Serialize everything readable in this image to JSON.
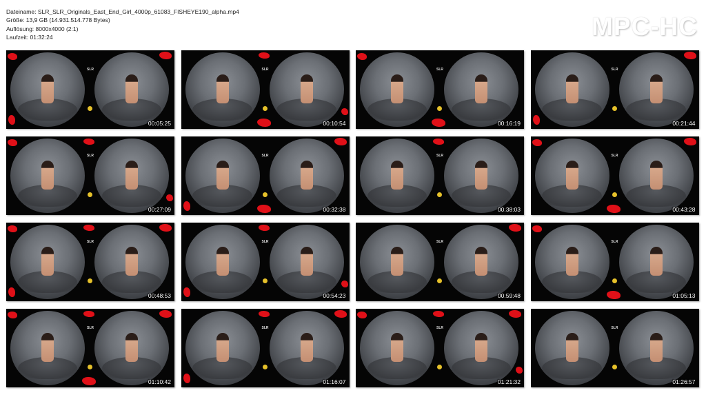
{
  "header": {
    "filename_line": "Dateiname: SLR_SLR_Originals_East_End_Girl_4000p_61083_FISHEYE190_alpha.mp4",
    "size_line": "Größe: 13,9 GB (14.931.514.778 Bytes)",
    "resolution_line": "Auflösung: 8000x4000 (2:1)",
    "duration_line": "Laufzeit: 01:32:24",
    "brand": "MPC-HC"
  },
  "thumbnail_logo": "SLR",
  "colors": {
    "background": "#ffffff",
    "thumb_background": "#050505",
    "splatter": "#e01018",
    "timestamp": "#ffffff"
  },
  "thumbnails": [
    {
      "time": "00:05:25"
    },
    {
      "time": "00:10:54"
    },
    {
      "time": "00:16:19"
    },
    {
      "time": "00:21:44"
    },
    {
      "time": "00:27:09"
    },
    {
      "time": "00:32:38"
    },
    {
      "time": "00:38:03"
    },
    {
      "time": "00:43:28"
    },
    {
      "time": "00:48:53"
    },
    {
      "time": "00:54:23"
    },
    {
      "time": "00:59:48"
    },
    {
      "time": "01:05:13"
    },
    {
      "time": "01:10:42"
    },
    {
      "time": "01:16:07"
    },
    {
      "time": "01:21:32"
    },
    {
      "time": "01:26:57"
    }
  ]
}
